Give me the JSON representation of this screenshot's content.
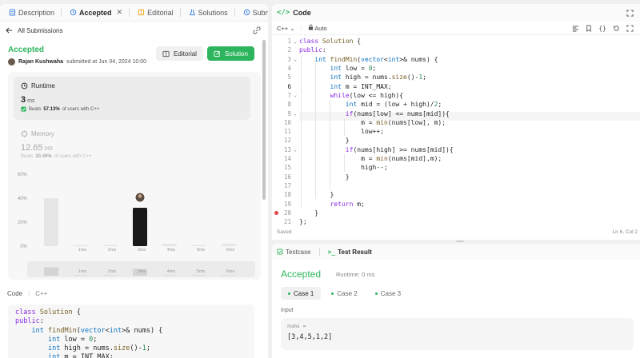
{
  "tabs": [
    {
      "label": "Description",
      "icon": "description-icon"
    },
    {
      "label": "Accepted",
      "icon": "history-icon",
      "active": true
    },
    {
      "label": "Editorial",
      "icon": "book-icon"
    },
    {
      "label": "Solutions",
      "icon": "flask-icon"
    },
    {
      "label": "Submissions",
      "icon": "history-icon"
    }
  ],
  "back_label": "All Submissions",
  "submission": {
    "status": "Accepted",
    "user": "Rajan Kushwaha",
    "submitted_text": "submitted at Jun 04, 2024 10:00",
    "editorial_label": "Editorial",
    "solution_label": "Solution"
  },
  "runtime": {
    "title": "Runtime",
    "value": "3",
    "unit": "ms",
    "beats_prefix": "Beats",
    "beats_pct": "57.13%",
    "beats_suffix": "of users with C++"
  },
  "memory": {
    "title": "Memory",
    "value": "12.65",
    "unit": "MB",
    "beats_prefix": "Beats",
    "beats_pct": "20.49%",
    "beats_suffix": "of users with C++"
  },
  "chart_data": {
    "type": "bar",
    "y_ticks": [
      "60%",
      "40%",
      "20%",
      "0%"
    ],
    "ylim": [
      0,
      60
    ],
    "categories": [
      "",
      "1ms",
      "2ms",
      "3ms",
      "4ms",
      "5ms",
      "6ms"
    ],
    "values": [
      40,
      1,
      1,
      32,
      2,
      1,
      2
    ],
    "highlight_index": 3
  },
  "code_label": "Code",
  "code_lang": "C++",
  "code_preview": [
    "class Solution {",
    "public:",
    "    int findMin(vector<int>& nums) {",
    "        int low = 0;",
    "        int high = nums.size()-1;",
    "        int m = INT_MAX;"
  ],
  "editor": {
    "title": "Code",
    "language": "C++",
    "mode": "Auto",
    "saved": "Saved",
    "cursor": "Ln 6, Col 2",
    "lines": [
      "class Solution {",
      "public:",
      "    int findMin(vector<int>& nums) {",
      "        int low = 0;",
      "        int high = nums.size()-1;",
      "        int m = INT_MAX;",
      "        while(low <= high){",
      "            int mid = (low + high)/2;",
      "            if(nums[low] <= nums[mid]){",
      "                m = min(nums[low], m);",
      "                low++;",
      "            }",
      "            if(nums[high] >= nums[mid]){",
      "                m = min(nums[mid],m);",
      "                high--;",
      "            }",
      "",
      "        }",
      "        return m;",
      "    }",
      "};"
    ]
  },
  "result": {
    "testcase_tab": "Testcase",
    "result_tab": "Test Result",
    "status": "Accepted",
    "runtime": "Runtime: 0 ms",
    "cases": [
      "Case 1",
      "Case 2",
      "Case 3"
    ],
    "input_label": "Input",
    "var_name": "nums =",
    "var_value": "[3,4,5,1,2]"
  }
}
